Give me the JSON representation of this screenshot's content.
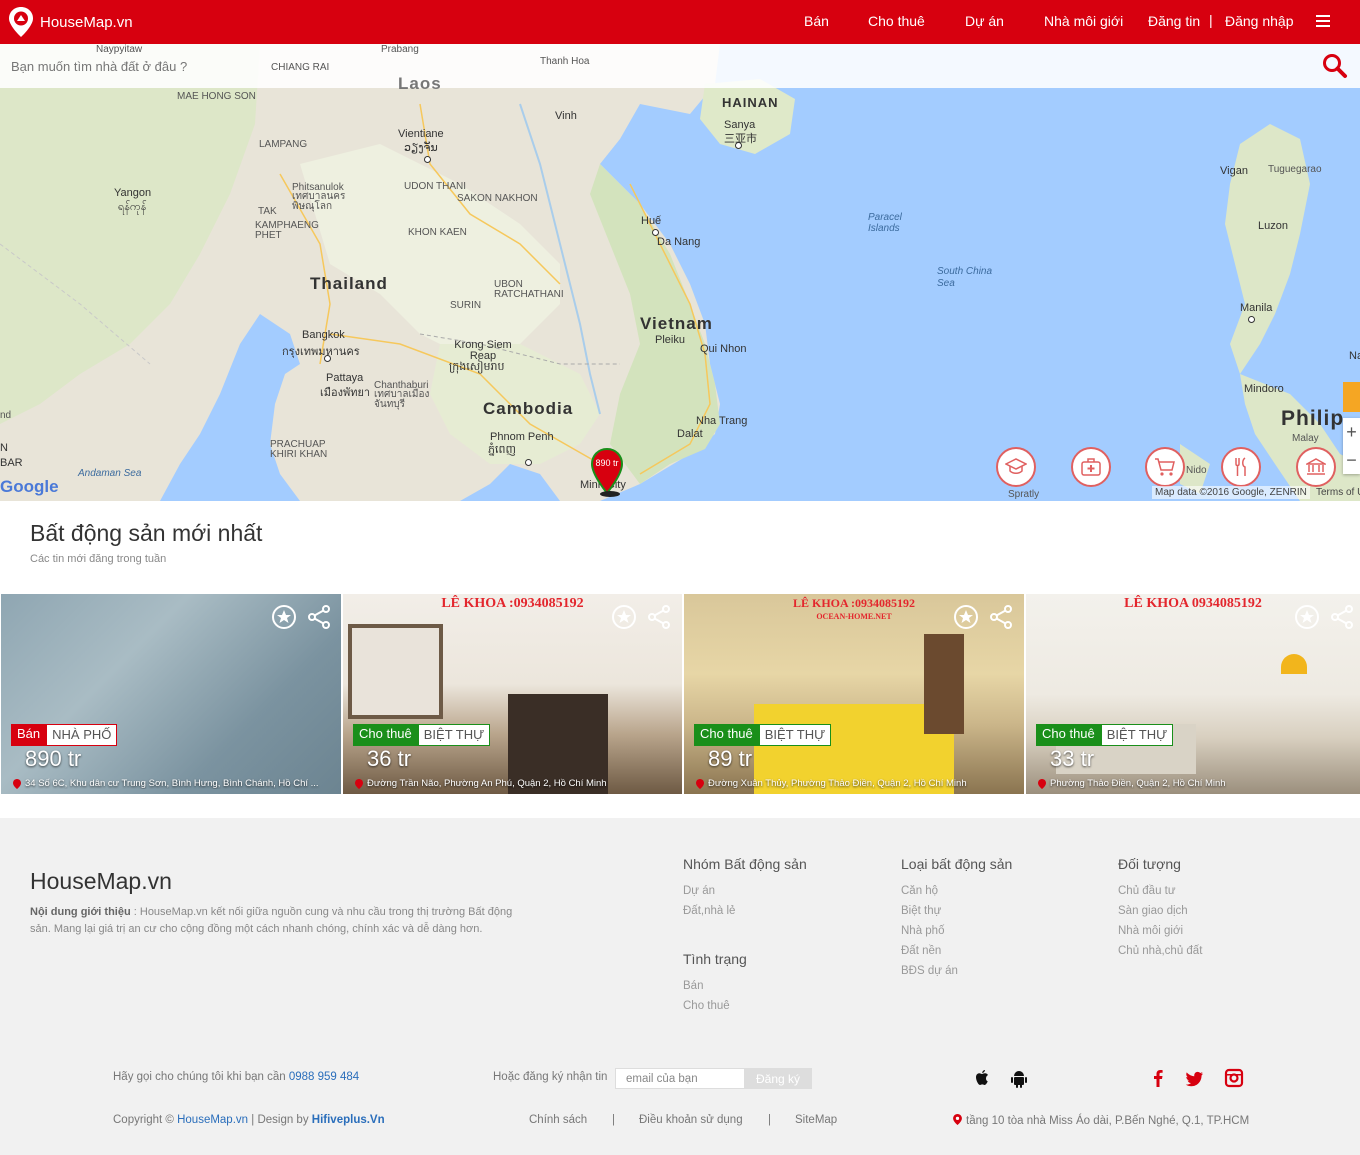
{
  "header": {
    "brand": "HouseMap.vn",
    "nav": [
      "Bán",
      "Cho thuê",
      "Dự án",
      "Nhà môi giới",
      "Đăng tin",
      "Đăng nhập"
    ],
    "separator": "|"
  },
  "search": {
    "placeholder": "Bạn muốn tìm nhà đất ở đâu ?"
  },
  "map": {
    "labels": {
      "thailand": "Thailand",
      "vietnam": "Vietnam",
      "cambodia": "Cambodia",
      "laos": "Laos",
      "hainan": "HAINAN",
      "philippines": "Philip",
      "vientiane": "Vientiane",
      "vientiane_local": "ວຽງຈັນ",
      "bangkok": "Bangkok",
      "bangkok_local": "กรุงเทพมหานคร",
      "yangon": "Yangon",
      "yangon_local": "ရန်ကုန်",
      "hue": "Huế",
      "danang": "Da Nang",
      "phnompenh": "Phnom Penh",
      "phnompenh_local": "ភ្នំពេញ",
      "manila": "Manila",
      "vinh": "Vinh",
      "sanya": "Sanya",
      "sanya_local": "三亚市",
      "siemreap": "Krong Siem Reap",
      "siemreap_local": "ក្រុងសៀមរាប",
      "pattaya": "Pattaya",
      "pattaya_local": "เมืองพัทยา",
      "chanthaburi": "Chanthaburi",
      "chanthaburi_local": "เทศบาลเมือง จันทบุรี",
      "quinhon": "Qui Nhon",
      "nhatrang": "Nha Trang",
      "dalat": "Dalat",
      "pleiku": "Pleiku",
      "hcm": "Minh City",
      "southchinasea": "South China Sea",
      "paracel": "Paracel Islands",
      "andaman": "Andaman Sea",
      "maehongson": "MAE HONG SON",
      "lampang": "LAMPANG",
      "phitsanulok": "Phitsanulok",
      "phitsanulok_local": "เทศบาลนคร พิษณุโลก",
      "udonthani": "UDON THANI",
      "sakonnakhon": "SAKON NAKHON",
      "khonkaen": "KHON KAEN",
      "ubon": "UBON RATCHATHANI",
      "surin": "SURIN",
      "tak": "TAK",
      "kamphaeng": "KAMPHAENG PHET",
      "prachuap": "PRACHUAP KHIRI KHAN",
      "vigan": "Vigan",
      "tuguegarao": "Tuguegarao",
      "luzon": "Luzon",
      "mindoro": "Mindoro",
      "malay": "Malay",
      "spratly": "Spratly",
      "naypyitaw": "Naypyitaw",
      "prabang": "Prabang",
      "thanhhoa": "Thanh Hoa",
      "chiangrai": "CHIANG RAI",
      "nido": "Nido",
      "dang": "nd",
      "bar": "BAR",
      "n": "N",
      "na": "Na"
    },
    "marker_price": "890 tr",
    "google": "Google",
    "attribution": "Map data ©2016 Google, ZENRIN",
    "terms": "Terms of U",
    "poi_icons": [
      "graduation-cap-icon",
      "medical-kit-icon",
      "shopping-cart-icon",
      "restaurant-icon",
      "bank-icon"
    ]
  },
  "latest": {
    "title": "Bất động sản mới nhất",
    "subtitle": "Các tin mới đăng trong tuần"
  },
  "listings": [
    {
      "status": "Bán",
      "status_color": "#d7000f",
      "type": "NHÀ PHỐ",
      "price": "890 tr",
      "address": "34 Số 6C, Khu dân cư Trung Sơn, Bình Hưng, Bình Chánh, Hồ Chí ...",
      "watermark": ""
    },
    {
      "status": "Cho thuê",
      "status_color": "#1a8f1a",
      "type": "BIỆT THỰ",
      "price": "36 tr",
      "address": "Đường Trần Não, Phường An Phú, Quận 2, Hồ Chí Minh",
      "watermark": "LÊ KHOA :0934085192"
    },
    {
      "status": "Cho thuê",
      "status_color": "#1a8f1a",
      "type": "BIỆT THỰ",
      "price": "89 tr",
      "address": "Đường Xuân Thủy, Phường Thảo Điền, Quận 2, Hồ Chí Minh",
      "watermark": "LÊ KHOA :0934085192",
      "watermark_sub": "OCEAN-HOME.NET"
    },
    {
      "status": "Cho thuê",
      "status_color": "#1a8f1a",
      "type": "BIỆT THỰ",
      "price": "33 tr",
      "address": "Phường Thảo Điền, Quận 2, Hồ Chí Minh",
      "watermark": "LÊ KHOA 0934085192"
    }
  ],
  "footer": {
    "brand": "HouseMap.vn",
    "desc_label": "Nội dung giới thiệu",
    "desc": " : HouseMap.vn kết nối giữa nguồn cung và nhu cầu trong thị trường Bất động sản. Mang lại giá trị an cư cho cộng đồng một cách nhanh chóng, chính xác và dễ dàng hơn.",
    "groups": {
      "nhom": {
        "title": "Nhóm Bất động sản",
        "items": [
          "Dự án",
          "Đất,nhà lẻ"
        ]
      },
      "tinhtrang": {
        "title": "Tình trạng",
        "items": [
          "Bán",
          "Cho thuê"
        ]
      },
      "loai": {
        "title": "Loại bất động sản",
        "items": [
          "Căn hộ",
          "Biệt thự",
          "Nhà phố",
          "Đất nền",
          "BĐS dự án"
        ]
      },
      "doituong": {
        "title": "Đối tượng",
        "items": [
          "Chủ đầu tư",
          "Sàn giao dịch",
          "Nhà môi giới",
          "Chủ nhà,chủ đất"
        ]
      }
    },
    "call_text": "Hãy gọi cho chúng tôi khi bạn cần ",
    "phone": "0988 959 484",
    "subscribe_text": "Hoặc đăng ký nhận tin",
    "email_placeholder": "email của bạn",
    "subscribe_btn": "Đăng ký",
    "copyright": "Copyright © ",
    "copyright_link": "HouseMap.vn",
    "design_by": " | Design by ",
    "designer": "Hifiveplus.Vn",
    "links": [
      "Chính sách",
      "Điều khoản sử dụng",
      "SiteMap"
    ],
    "link_sep": "|",
    "address": "tầng 10 tòa nhà Miss Áo dài, P.Bến Nghé, Q.1, TP.HCM",
    "accent": "#d7000f",
    "link_color": "#2a6ebb"
  }
}
